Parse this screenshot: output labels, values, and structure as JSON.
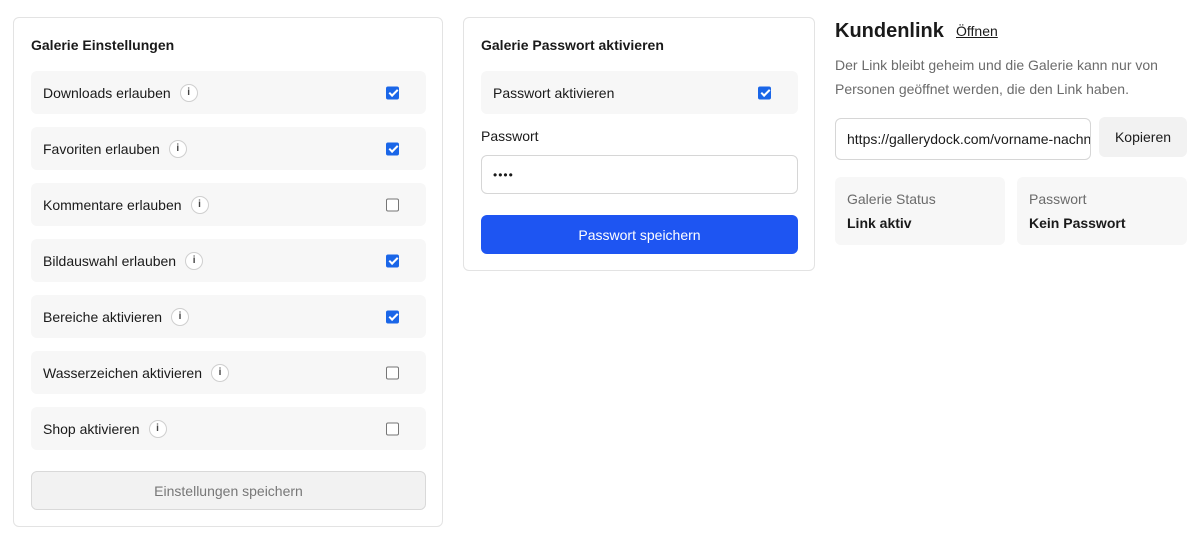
{
  "settings": {
    "title": "Galerie Einstellungen",
    "items": [
      {
        "label": "Downloads erlauben",
        "info": "i",
        "checked": true
      },
      {
        "label": "Favoriten erlauben",
        "info": "i",
        "checked": true
      },
      {
        "label": "Kommentare erlauben",
        "info": "i",
        "checked": false
      },
      {
        "label": "Bildauswahl erlauben",
        "info": "i",
        "checked": true
      },
      {
        "label": "Bereiche aktivieren",
        "info": "i",
        "checked": true
      },
      {
        "label": "Wasserzeichen aktivieren",
        "info": "i",
        "checked": false
      },
      {
        "label": "Shop aktivieren",
        "info": "i",
        "checked": false
      }
    ],
    "save_label": "Einstellungen speichern"
  },
  "password": {
    "title": "Galerie Passwort aktivieren",
    "toggle_label": "Passwort aktivieren",
    "toggle_checked": true,
    "field_label": "Passwort",
    "field_value": "••••",
    "save_label": "Passwort speichern"
  },
  "customer_link": {
    "title": "Kundenlink",
    "open_label": "Öffnen",
    "description": "Der Link bleibt geheim und die Galerie kann nur von Personen geöffnet werden, die den Link haben.",
    "url": "https://gallerydock.com/vorname-nachname",
    "copy_label": "Kopieren",
    "status_label": "Galerie Status",
    "status_value": "Link aktiv",
    "password_label": "Passwort",
    "password_value": "Kein Passwort"
  },
  "colors": {
    "accent": "#1e55f2",
    "checkbox": "#1a66e8"
  }
}
